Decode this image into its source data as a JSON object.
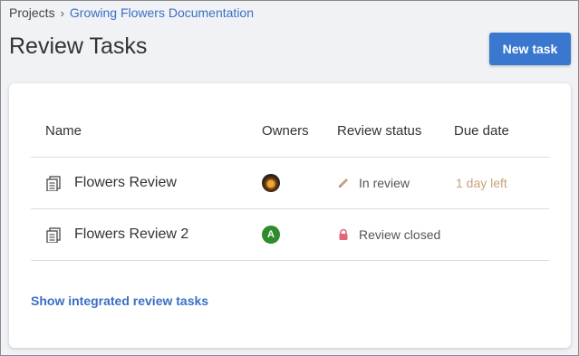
{
  "breadcrumb": {
    "root": "Projects",
    "separator": "›",
    "current": "Growing Flowers Documentation"
  },
  "page": {
    "title": "Review Tasks",
    "new_task_label": "New task"
  },
  "table": {
    "columns": [
      "Name",
      "Owners",
      "Review status",
      "Due date"
    ],
    "rows": [
      {
        "name": "Flowers Review",
        "owner_avatar": "photo",
        "owner_initial": "",
        "status_icon": "pencil-icon",
        "status": "In review",
        "due": "1 day left",
        "due_color": "#c9a27a"
      },
      {
        "name": "Flowers Review 2",
        "owner_avatar": "letter",
        "owner_initial": "A",
        "status_icon": "lock-icon",
        "status": "Review closed",
        "due": "",
        "due_color": "#c9a27a"
      }
    ]
  },
  "footer": {
    "show_integrated_label": "Show integrated review tasks"
  },
  "colors": {
    "accent": "#3a77cf",
    "link": "#3a6fc4",
    "pencil": "#c9a27a",
    "lock": "#e0677a"
  }
}
